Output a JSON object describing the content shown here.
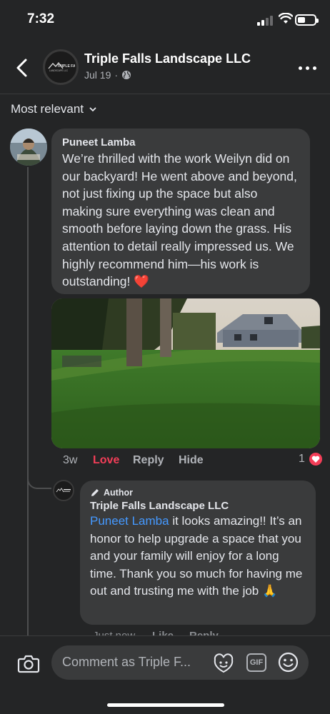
{
  "status_bar": {
    "time": "7:32"
  },
  "header": {
    "page_name": "Triple Falls Landscape LLC",
    "date": "Jul 19",
    "separator": "·",
    "avatar_logo_text": "TRIPLE FALLS LANDSCAPE LLC"
  },
  "sort": {
    "label": "Most relevant"
  },
  "comment": {
    "author": "Puneet Lamba",
    "text": "We’re thrilled with the work Weilyn did on our backyard! He went above and beyond, not just fixing up the space but also making sure everything was clean and smooth before laying down the grass. His attention to detail really impressed us. We highly recommend him—his work is outstanding!",
    "emoji": "❤️",
    "time": "3w",
    "love_label": "Love",
    "reply_label": "Reply",
    "hide_label": "Hide",
    "reaction_count": "1"
  },
  "reply": {
    "badge": "Author",
    "author": "Triple Falls Landscape LLC",
    "mention": "Puneet Lamba",
    "text": " it looks amazing!! It’s an honor to help upgrade a space that you and your family will enjoy for a long time. Thank you so much for having me out and trusting me with the job",
    "emoji": "🙏",
    "time": "Just now",
    "like_label": "Like",
    "reply_label": "Reply"
  },
  "composer": {
    "placeholder": "Comment as Triple F...",
    "gif_label": "GIF"
  },
  "colors": {
    "background": "#242526",
    "bubble": "#3a3b3c",
    "love": "#f33e58",
    "mention": "#4599ff"
  }
}
